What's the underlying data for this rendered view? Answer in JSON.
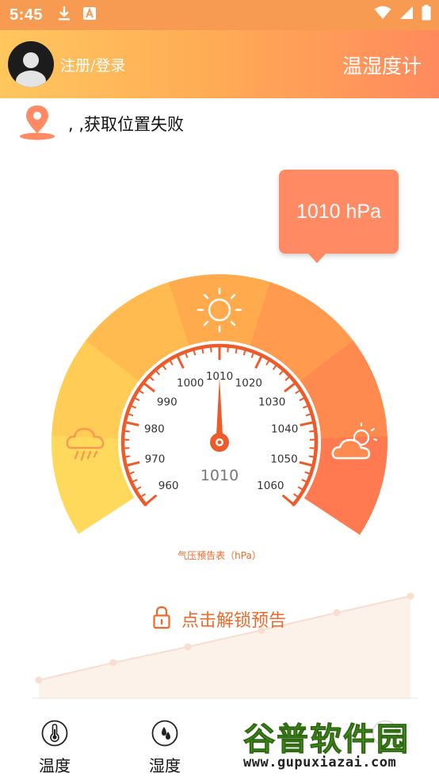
{
  "status_bar": {
    "time": "5:45",
    "icons": [
      "download-icon",
      "app-a-icon",
      "wifi-icon",
      "signal-icon",
      "battery-icon"
    ]
  },
  "header": {
    "login_label": "注册/登录",
    "app_title": "温湿度计"
  },
  "location": {
    "text": ", ,获取位置失败",
    "icon": "location-pin-icon"
  },
  "tooltip": {
    "value_text": "1010 hPa"
  },
  "gauge": {
    "current_value": 1010,
    "center_readout": "1010",
    "min": 960,
    "max": 1060,
    "unit": "hPa",
    "scale_labels": [
      "960",
      "970",
      "980",
      "990",
      "1000",
      "1010",
      "1020",
      "1030",
      "1040",
      "1050",
      "1060"
    ],
    "caption": "气压预告表（hPa）",
    "zone_icons": [
      "rain-cloud-icon",
      "sun-icon",
      "partly-cloudy-icon"
    ],
    "colors": {
      "needle": "#ef5a2a",
      "scale": "#ef5a2a",
      "zones": [
        "#ffd95c",
        "#ffcc55",
        "#ffbb4f",
        "#ffaa4c",
        "#ff9a4e",
        "#ff8a50",
        "#ff7a50"
      ]
    }
  },
  "forecast": {
    "unlock_label": "点击解锁预告",
    "icon": "lock-icon"
  },
  "bottom_nav": {
    "items": [
      {
        "label": "温度",
        "icon": "thermometer-icon"
      },
      {
        "label": "湿度",
        "icon": "droplet-icon"
      },
      {
        "label": "",
        "icon": "more-icon"
      }
    ]
  },
  "watermark": {
    "brand": "谷普软件园",
    "url": "www.gupuxiazai.com"
  },
  "colors": {
    "accent": "#ef6a2a",
    "header_start": "#ffc75e",
    "header_end": "#ff8a5d",
    "tooltip": "#ff8a64"
  }
}
